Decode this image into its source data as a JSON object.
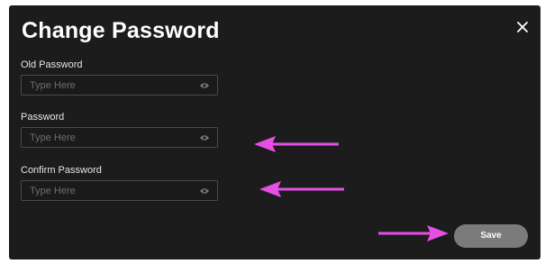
{
  "dialog": {
    "title": "Change Password",
    "close_icon": "close-icon",
    "fields": [
      {
        "label": "Old Password",
        "placeholder": "Type Here",
        "value": "",
        "icon": "eye-icon"
      },
      {
        "label": "Password",
        "placeholder": "Type Here",
        "value": "",
        "icon": "eye-icon"
      },
      {
        "label": "Confirm Password",
        "placeholder": "Type Here",
        "value": "",
        "icon": "eye-icon"
      }
    ],
    "save_label": "Save"
  },
  "annotations": {
    "arrow_color": "#e64fe6",
    "arrows": [
      {
        "target": "password-field",
        "direction": "left"
      },
      {
        "target": "confirm-password-field",
        "direction": "left"
      },
      {
        "target": "save-button",
        "direction": "right"
      }
    ]
  },
  "colors": {
    "dialog_background": "#1c1c1c",
    "save_button": "#7b7b7b"
  }
}
